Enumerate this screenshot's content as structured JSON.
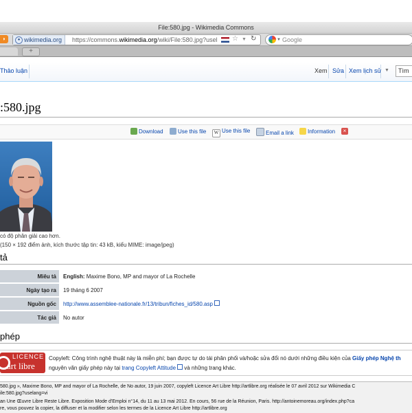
{
  "window": {
    "title": "File:580.jpg - Wikimedia Commons"
  },
  "browser": {
    "site_identity": "wikimedia.org",
    "url_prefix": "https://commons.",
    "url_host": "wikimedia.org",
    "url_rest": "/wiki/File:580.jpg?usel",
    "search_placeholder": "Google",
    "new_tab_label": "+"
  },
  "wiki_tabs": {
    "talk": "Thảo luận",
    "view": "Xem",
    "edit": "Sửa",
    "history": "Xem lịch sử",
    "search_value": "Tìm"
  },
  "page": {
    "title": ":580.jpg"
  },
  "toolbar": {
    "download": "Download",
    "use_this_file_1": "Use this file",
    "use_this_file_2": "Use this file",
    "email_link": "Email a link",
    "information": "Information",
    "close": "×"
  },
  "file": {
    "caption_1": "có độ phân giải cao hơn.",
    "caption_2": "(150 × 192 điểm ảnh, kích thước tập tin: 43 kB, kiểu MIME: image/jpeg)"
  },
  "sections": {
    "description": "tả",
    "license": "phép"
  },
  "info": {
    "rows": [
      {
        "label": "Miêu tả",
        "lang": "English:",
        "value": "Maxime Bono, MP and mayor of La Rochelle"
      },
      {
        "label": "Ngày tạo ra",
        "value": "19 tháng 6 2007"
      },
      {
        "label": "Nguồn gốc",
        "value": "http://www.assemblee-nationale.fr/13/tribun/fiches_id/580.asp"
      },
      {
        "label": "Tác giả",
        "value": "No autor"
      }
    ]
  },
  "licence": {
    "logo_top": "LICENCE",
    "logo_bottom": "art libre",
    "line1": "Copyleft: Công trình nghệ thuật này là miễn phí; bạn được tự do tái phân phối và/hoặc sửa đổi nó dưới những điều kiện của ",
    "line1_link": "Giấy phép Nghệ th",
    "line2_a": "nguyên văn giấy phép này tại ",
    "line2_link": "trang Copyleft Attitude",
    "line2_b": " và những trang khác."
  },
  "footer": {
    "line1": "580.jpg », Maxime Bono, MP and mayor of La Rochelle, de No autor, 19 juin 2007, copyleft Licence Art Libre http://artlibre.org réalisée le 07 avril 2012  sur Wikimedia C",
    "line2": "ile:580.jpg?uselang=vi",
    "line3": "an Une Œuvre Libre Reste Libre. Exposition Mode d'Emploi n°14, du 11 au 13 mai 2012. En cours, 56 rue de la Réunion, Paris. http://antoinemoreau.org/index.php?ca",
    "line4": "re, vous pouvez la copier, la diffuser et la modifier selon les termes de la Licence Art Libre http://artlibre.org"
  }
}
